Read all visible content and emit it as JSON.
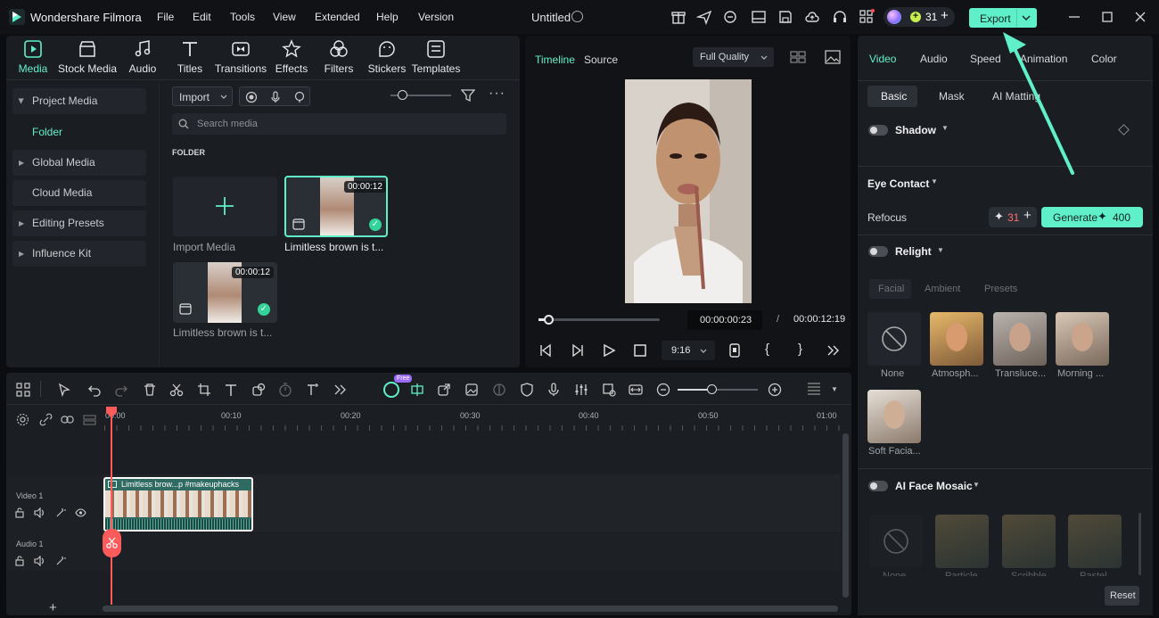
{
  "app": {
    "title": "Wondershare Filmora",
    "project": "Untitled"
  },
  "menu": [
    "File",
    "Edit",
    "Tools",
    "View",
    "Extended",
    "Help",
    "Version"
  ],
  "credits": "31",
  "export_label": "Export",
  "toolbar": [
    "Media",
    "Stock Media",
    "Audio",
    "Titles",
    "Transitions",
    "Effects",
    "Filters",
    "Stickers",
    "Templates"
  ],
  "sidebar": {
    "items": [
      "Project Media",
      "Folder",
      "Global Media",
      "Cloud Media",
      "Editing Presets",
      "Influence Kit"
    ]
  },
  "media": {
    "import_label": "Import",
    "search_placeholder": "Search media",
    "folder_heading": "FOLDER",
    "import_media_label": "Import Media",
    "clips": [
      {
        "name": "Limitless brown is t...",
        "duration": "00:00:12"
      },
      {
        "name": "Limitless brown is t...",
        "duration": "00:00:12"
      }
    ]
  },
  "preview": {
    "tabs": [
      "Timeline",
      "Source"
    ],
    "quality": "Full Quality",
    "current_time": "00:00:00:23",
    "separator": "/",
    "total_time": "00:00:12:19",
    "ratio": "9:16"
  },
  "properties": {
    "tabs": [
      "Video",
      "Audio",
      "Speed",
      "Animation",
      "Color"
    ],
    "subtabs": [
      "Basic",
      "Mask",
      "AI Matting"
    ],
    "shadow_label": "Shadow",
    "eye_contact_label": "Eye Contact",
    "refocus_label": "Refocus",
    "refocus_credits": "31",
    "generate_label": "Generate",
    "generate_cost": "400",
    "relight_label": "Relight",
    "relight_tabs": [
      "Facial",
      "Ambient",
      "Presets"
    ],
    "relight_presets": [
      "None",
      "Atmosph...",
      "Transluce...",
      "Morning ...",
      "Soft Facia..."
    ],
    "face_mosaic_label": "AI Face Mosaic",
    "mosaic_presets": [
      "None",
      "Particle",
      "Scribble",
      "Pastel"
    ],
    "reset_label": "Reset"
  },
  "timeline": {
    "ruler": [
      "00:00",
      "00:10",
      "00:20",
      "00:30",
      "00:40",
      "00:50",
      "01:00"
    ],
    "tracks": [
      {
        "name": "Video 1",
        "clip": "Limitless brow...p #makeuphacks"
      },
      {
        "name": "Audio 1"
      }
    ],
    "free_badge": "Free"
  },
  "colors": {
    "accent": "#5ff0c9",
    "bg": "#1a1d22",
    "playhead": "#ff5b5b"
  }
}
